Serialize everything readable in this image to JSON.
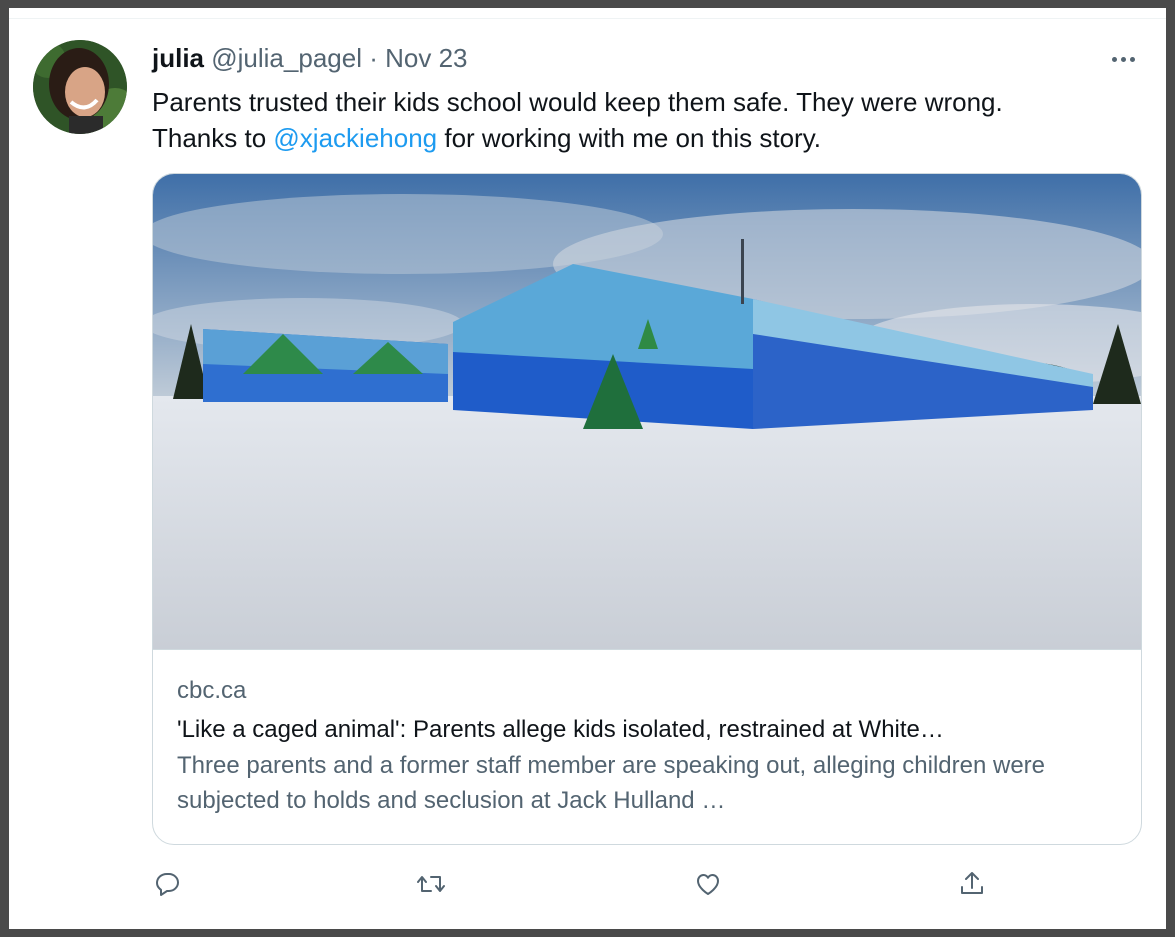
{
  "tweet": {
    "author_name": "julia",
    "handle": "@julia_pagel",
    "separator": "·",
    "date": "Nov 23",
    "text_line1": "Parents trusted their kids school would keep them safe. They were wrong.",
    "text_line2_prefix": "Thanks to ",
    "mention": "@xjackiehong",
    "text_line2_suffix": " for working with me on this story."
  },
  "card": {
    "domain": "cbc.ca",
    "title": "'Like a caged animal': Parents allege kids isolated, restrained at White…",
    "description": "Three parents and a former staff member are speaking out, alleging children were subjected to holds and seclusion at Jack Hulland …"
  },
  "actions": {
    "icons": [
      "reply-icon",
      "retweet-icon",
      "like-icon",
      "share-icon"
    ]
  },
  "colors": {
    "link": "#1d9bf0",
    "secondary_text": "#536471",
    "primary_text": "#0f1419"
  }
}
